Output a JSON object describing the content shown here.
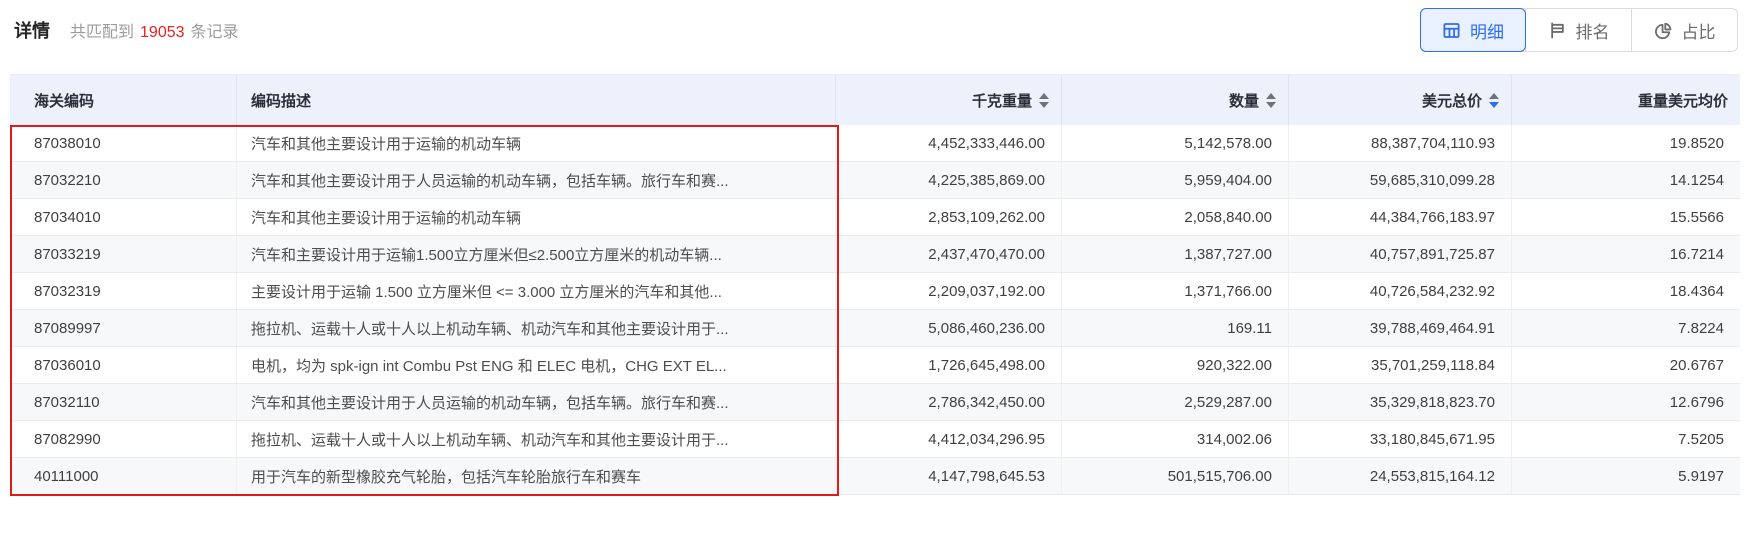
{
  "header": {
    "title": "详情",
    "match_prefix": "共匹配到",
    "match_count": "19053",
    "match_suffix": "条记录"
  },
  "view_switcher": {
    "options": [
      {
        "label": "明细",
        "icon": "table-grid-icon",
        "active": true
      },
      {
        "label": "排名",
        "icon": "ranking-flag-icon",
        "active": false
      },
      {
        "label": "占比",
        "icon": "pie-chart-icon",
        "active": false
      }
    ]
  },
  "colors": {
    "accent_blue": "#2e6cf0",
    "count_red": "#e8231d",
    "highlight_box_red": "#e01a1a",
    "table_header_bg": "#ecf1fb"
  },
  "annotation": {
    "type": "highlight-box",
    "rows_covered": "1-10",
    "columns_covered": "海关编码, 编码描述"
  },
  "table": {
    "columns": [
      {
        "key": "code",
        "label": "海关编码",
        "align": "left",
        "sortable": false,
        "sort": null
      },
      {
        "key": "desc",
        "label": "编码描述",
        "align": "left",
        "sortable": false,
        "sort": null
      },
      {
        "key": "weight",
        "label": "千克重量",
        "align": "right",
        "sortable": true,
        "sort": null
      },
      {
        "key": "qty",
        "label": "数量",
        "align": "right",
        "sortable": true,
        "sort": null
      },
      {
        "key": "usd",
        "label": "美元总价",
        "align": "right",
        "sortable": true,
        "sort": "desc"
      },
      {
        "key": "avg",
        "label": "重量美元均价",
        "align": "right",
        "sortable": false,
        "sort": null
      }
    ],
    "rows": [
      {
        "code": "87038010",
        "desc": "汽车和其他主要设计用于运输的机动车辆",
        "weight": "4,452,333,446.00",
        "qty": "5,142,578.00",
        "usd": "88,387,704,110.93",
        "avg": "19.8520"
      },
      {
        "code": "87032210",
        "desc": "汽车和其他主要设计用于人员运输的机动车辆，包括车辆。旅行车和赛...",
        "weight": "4,225,385,869.00",
        "qty": "5,959,404.00",
        "usd": "59,685,310,099.28",
        "avg": "14.1254"
      },
      {
        "code": "87034010",
        "desc": "汽车和其他主要设计用于运输的机动车辆",
        "weight": "2,853,109,262.00",
        "qty": "2,058,840.00",
        "usd": "44,384,766,183.97",
        "avg": "15.5566"
      },
      {
        "code": "87033219",
        "desc": "汽车和主要设计用于运输1.500立方厘米但≤2.500立方厘米的机动车辆...",
        "weight": "2,437,470,470.00",
        "qty": "1,387,727.00",
        "usd": "40,757,891,725.87",
        "avg": "16.7214"
      },
      {
        "code": "87032319",
        "desc": "主要设计用于运输 1.500 立方厘米但 <= 3.000 立方厘米的汽车和其他...",
        "weight": "2,209,037,192.00",
        "qty": "1,371,766.00",
        "usd": "40,726,584,232.92",
        "avg": "18.4364"
      },
      {
        "code": "87089997",
        "desc": "拖拉机、运载十人或十人以上机动车辆、机动汽车和其他主要设计用于...",
        "weight": "5,086,460,236.00",
        "qty": "169.11",
        "usd": "39,788,469,464.91",
        "avg": "7.8224"
      },
      {
        "code": "87036010",
        "desc": "电机，均为 spk-ign int Combu Pst ENG 和 ELEC 电机，CHG EXT EL...",
        "weight": "1,726,645,498.00",
        "qty": "920,322.00",
        "usd": "35,701,259,118.84",
        "avg": "20.6767"
      },
      {
        "code": "87032110",
        "desc": "汽车和其他主要设计用于人员运输的机动车辆，包括车辆。旅行车和赛...",
        "weight": "2,786,342,450.00",
        "qty": "2,529,287.00",
        "usd": "35,329,818,823.70",
        "avg": "12.6796"
      },
      {
        "code": "87082990",
        "desc": "拖拉机、运载十人或十人以上机动车辆、机动汽车和其他主要设计用于...",
        "weight": "4,412,034,296.95",
        "qty": "314,002.06",
        "usd": "33,180,845,671.95",
        "avg": "7.5205"
      },
      {
        "code": "40111000",
        "desc": "用于汽车的新型橡胶充气轮胎，包括汽车轮胎旅行车和赛车",
        "weight": "4,147,798,645.53",
        "qty": "501,515,706.00",
        "usd": "24,553,815,164.12",
        "avg": "5.9197"
      }
    ]
  }
}
